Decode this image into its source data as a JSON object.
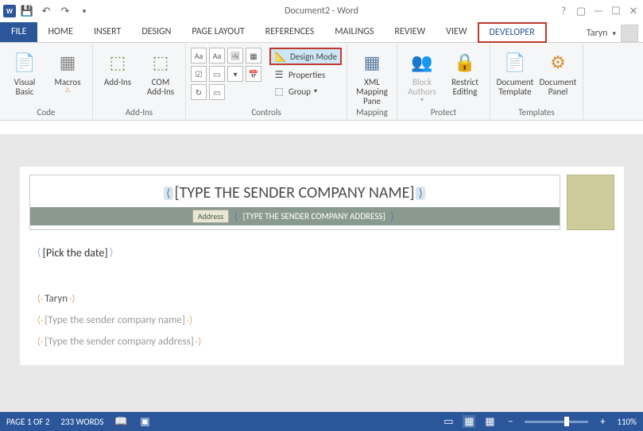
{
  "titlebar": {
    "title": "Document2 - Word",
    "app_icon": "W"
  },
  "tabs": {
    "file": "FILE",
    "items": [
      "HOME",
      "INSERT",
      "DESIGN",
      "PAGE LAYOUT",
      "REFERENCES",
      "MAILINGS",
      "REVIEW",
      "VIEW",
      "DEVELOPER"
    ],
    "active": "DEVELOPER",
    "user": "Taryn"
  },
  "ribbon": {
    "code": {
      "label": "Code",
      "visual_basic": "Visual\nBasic",
      "macros": "Macros"
    },
    "addins": {
      "label": "Add-Ins",
      "addins": "Add-Ins",
      "com": "COM\nAdd-Ins"
    },
    "controls": {
      "label": "Controls",
      "design_mode": "Design Mode",
      "properties": "Properties",
      "group": "Group"
    },
    "mapping": {
      "label": "Mapping",
      "xml": "XML Mapping\nPane"
    },
    "protect": {
      "label": "Protect",
      "block": "Block\nAuthors",
      "restrict": "Restrict\nEditing"
    },
    "templates": {
      "label": "Templates",
      "tmpl": "Document\nTemplate",
      "panel": "Document\nPanel"
    }
  },
  "document": {
    "sender_name": "[TYPE THE SENDER COMPANY NAME]",
    "addr_label": "Address",
    "sender_addr": "[TYPE THE SENDER COMPANY ADDRESS]",
    "date": "[Pick the date]",
    "signer": "Taryn",
    "line2": "[Type the sender company name]",
    "line3": "[Type the sender company address]"
  },
  "status": {
    "page": "PAGE 1 OF 2",
    "words": "233 WORDS",
    "zoom": "110%"
  }
}
